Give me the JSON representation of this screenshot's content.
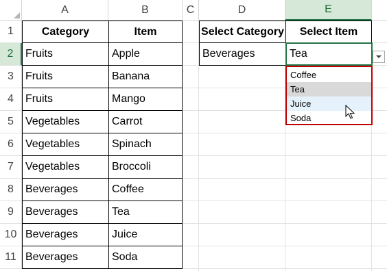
{
  "columns": [
    "A",
    "B",
    "C",
    "D",
    "E"
  ],
  "rows": [
    "1",
    "2",
    "3",
    "4",
    "5",
    "6",
    "7",
    "8",
    "9",
    "10",
    "11"
  ],
  "table": {
    "headers": [
      "Category",
      "Item"
    ],
    "rows": [
      [
        "Fruits",
        "Apple"
      ],
      [
        "Fruits",
        "Banana"
      ],
      [
        "Fruits",
        "Mango"
      ],
      [
        "Vegetables",
        "Carrot"
      ],
      [
        "Vegetables",
        "Spinach"
      ],
      [
        "Vegetables",
        "Broccoli"
      ],
      [
        "Beverages",
        "Coffee"
      ],
      [
        "Beverages",
        "Tea"
      ],
      [
        "Beverages",
        "Juice"
      ],
      [
        "Beverages",
        "Soda"
      ]
    ]
  },
  "selector": {
    "category_header": "Select Category",
    "item_header": "Select Item",
    "category_value": "Beverages",
    "item_value": "Tea"
  },
  "dropdown": {
    "options": [
      "Coffee",
      "Tea",
      "Juice",
      "Soda"
    ],
    "selected": "Tea",
    "hovered": "Juice"
  },
  "colors": {
    "accent": "#217346",
    "dropdown_border": "#c00000",
    "selected_bg": "#d9d9d9",
    "hover_bg": "#e5f1fb"
  }
}
